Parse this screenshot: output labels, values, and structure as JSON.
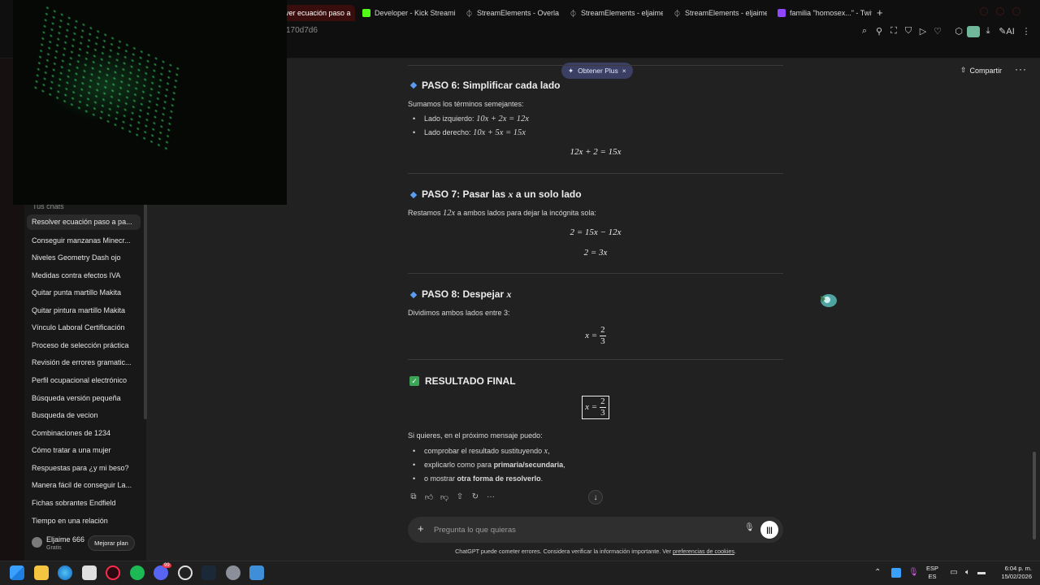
{
  "browser": {
    "tabs": [
      {
        "label": "ver ecuación paso a",
        "icon": "chatgpt-icon",
        "active": true
      },
      {
        "label": "Developer - Kick Streamin",
        "icon": "kick-icon"
      },
      {
        "label": "StreamElements - Overlay",
        "icon": "streamelements-icon"
      },
      {
        "label": "StreamElements - eljaime",
        "icon": "streamelements-icon"
      },
      {
        "label": "StreamElements - eljaime",
        "icon": "streamelements-icon"
      },
      {
        "label": "familia \"homosex...\" - Twit",
        "icon": "twitch-icon"
      }
    ],
    "new_tab": "+",
    "url": "170d7d6",
    "toolbar_icons": [
      "search-icon",
      "pin-icon",
      "crop-icon",
      "shield-icon",
      "play-icon",
      "heart-icon",
      "extensions-icon",
      "profile-icon",
      "download-icon",
      "ai-icon",
      "more-icon"
    ],
    "ai_label": "AI"
  },
  "header": {
    "plus_label": "Obtener Plus",
    "plus_close": "×",
    "share_label": "Compartir",
    "more": "···"
  },
  "sidebar": {
    "heading": "Tus chats",
    "items": [
      "Resolver ecuación paso a pa...",
      "Conseguir manzanas Minecr...",
      "Niveles Geometry Dash ojo",
      "Medidas contra efectos IVA",
      "Quitar punta martillo Makita",
      "Quitar pintura martillo Makita",
      "Vínculo Laboral Certificación",
      "Proceso de selección práctica",
      "Revisión de errores gramatic...",
      "Perfil ocupacional electrónico",
      "Búsqueda versión pequeña",
      "Busqueda de vecion",
      "Combinaciones de 1234",
      "Cómo tratar a una mujer",
      "Respuestas para ¿y mi beso?",
      "Manera fácil de conseguir La...",
      "Fichas sobrantes Endfield",
      "Tiempo en una relación"
    ],
    "user": {
      "name": "Eljaime 666",
      "plan": "Gratis",
      "upgrade": "Mejorar plan"
    }
  },
  "content": {
    "step6": {
      "title": "PASO 6: Simplificar cada lado",
      "intro": "Sumamos los términos semejantes:",
      "left_label": "Lado izquierdo:",
      "left_eq": "10x + 2x = 12x",
      "right_label": "Lado derecho:",
      "right_eq": "10x + 5x = 15x",
      "result": "12x + 2 = 15x"
    },
    "step7": {
      "title_a": "PASO 7: Pasar las",
      "title_var": "x",
      "title_b": "a un solo lado",
      "intro_a": "Restamos",
      "intro_term": "12x",
      "intro_b": "a ambos lados para dejar la incógnita sola:",
      "eq1": "2 = 15x − 12x",
      "eq2": "2 = 3x"
    },
    "step8": {
      "title": "PASO 8: Despejar",
      "title_var": "x",
      "intro": "Dividimos ambos lados entre 3:",
      "lhs": "x =",
      "num": "2",
      "den": "3"
    },
    "final": {
      "title": "RESULTADO FINAL",
      "lhs": "x =",
      "num": "2",
      "den": "3"
    },
    "followup": {
      "intro": "Si quieres, en el próximo mensaje puedo:",
      "opt1_a": "comprobar el resultado sustituyendo",
      "opt1_var": "x",
      "opt1_b": ",",
      "opt2_a": "explicarlo como para",
      "opt2_bold": "primaria/secundaria",
      "opt2_b": ",",
      "opt3_a": "o mostrar",
      "opt3_bold": "otra forma de resolverlo",
      "opt3_b": "."
    },
    "actions": [
      "copy-icon",
      "thumbs-up-icon",
      "thumbs-down-icon",
      "share-icon",
      "regenerate-icon",
      "more-icon"
    ],
    "scroll_down": "↓"
  },
  "composer": {
    "placeholder": "Pregunta lo que quieras",
    "plus": "+"
  },
  "disclaimer": {
    "text": "ChatGPT puede cometer errores. Considera verificar la información importante. Ver",
    "link": "preferencias de cookies",
    "end": "."
  },
  "taskbar": {
    "apps": [
      "windows-start-icon",
      "file-explorer-icon",
      "edge-icon",
      "store-icon",
      "opera-gx-icon",
      "spotify-icon",
      "discord-icon",
      "obs-icon",
      "steam-icon",
      "settings-icon",
      "app-icon"
    ],
    "discord_badge": "99",
    "lang_top": "ESP",
    "lang_bottom": "ES",
    "time": "6:04 p. m.",
    "date": "15/02/2026"
  },
  "colors": {
    "bg": "#212121",
    "sidebar": "#181818",
    "accent_blue": "#5b9bf0",
    "check_green": "#3aa655",
    "plus_pill": "#3a3f63"
  }
}
